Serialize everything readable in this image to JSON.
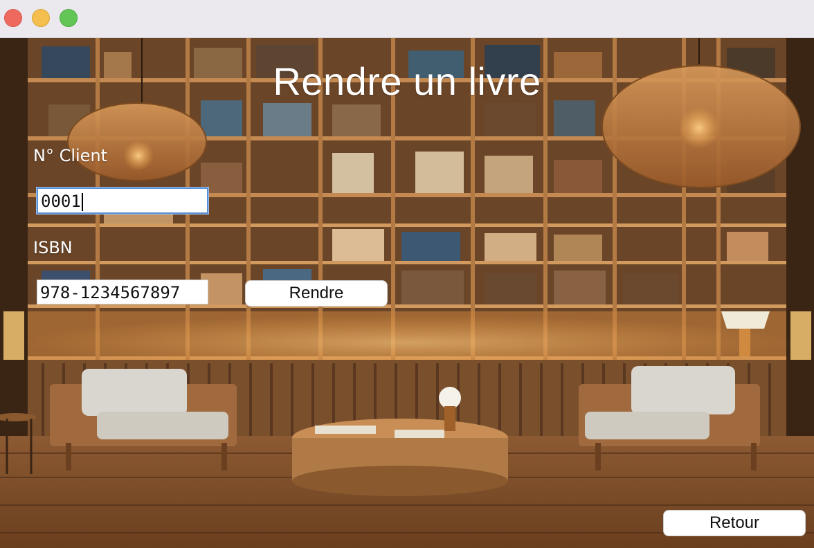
{
  "window": {
    "controls": [
      "close",
      "minimize",
      "zoom"
    ]
  },
  "page": {
    "title": "Rendre un livre"
  },
  "form": {
    "client_label": "N° Client",
    "client_value": "0001",
    "isbn_label": "ISBN",
    "isbn_value": "978-1234567897",
    "submit_label": "Rendre"
  },
  "footer": {
    "back_label": "Retour"
  },
  "background": {
    "description_icon": "library-interior-image"
  }
}
